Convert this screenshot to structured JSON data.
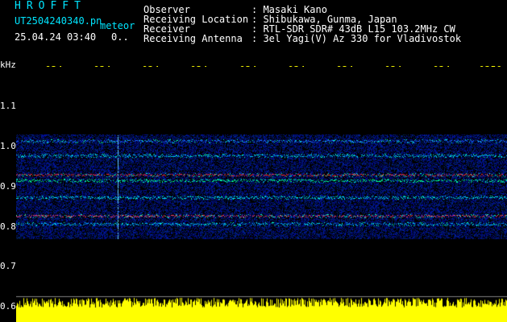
{
  "header": {
    "brand": "HROFFT",
    "filename": "UT2504240340.pn",
    "tag": "meteor",
    "datetime": "25.04.24 03:40",
    "datetime_suffix": "0..",
    "info": [
      {
        "label": "Observer",
        "value": ": Masaki Kano"
      },
      {
        "label": "Receiving Location",
        "value": ": Shibukawa, Gunma, Japan"
      },
      {
        "label": "Receiver",
        "value": ": RTL-SDR SDR# 43dB L15 103.2MHz CW"
      },
      {
        "label": "Receiving Antenna",
        "value": ": 3el Yagi(V) Az 330 for Vladivostok"
      }
    ]
  },
  "axis": {
    "y_unit": "kHz",
    "y_ticks": [
      "1.1",
      "1.0",
      "0.9",
      "0.8",
      "0.7",
      "0.6"
    ],
    "x_ticks": [
      "034",
      "034",
      "034",
      "034",
      "034",
      "034",
      "034",
      "034",
      "034",
      "0350"
    ]
  },
  "colors": {
    "label_cyan": "#00e5ff",
    "label_yellow": "#ffff00",
    "spectrum_yellow": "#ffff00"
  }
}
